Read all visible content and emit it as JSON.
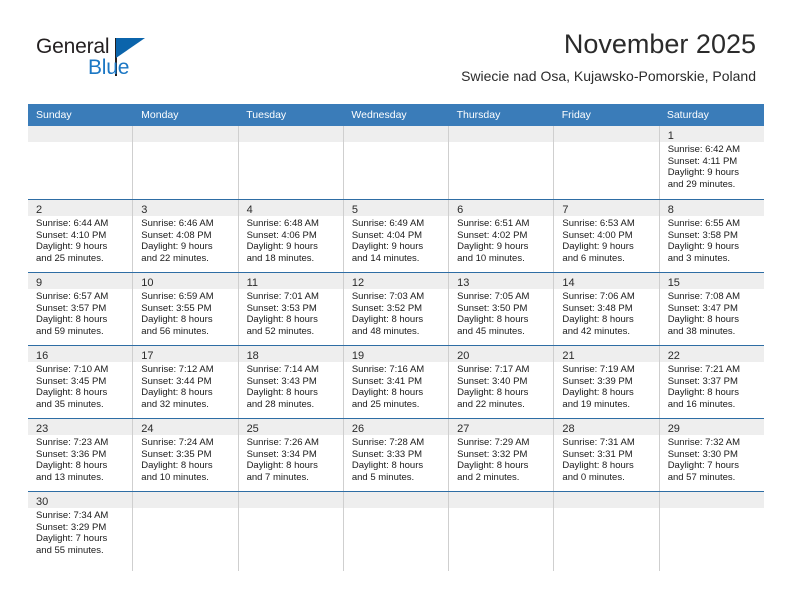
{
  "brand": {
    "name_part1": "General",
    "name_part2": "Blue",
    "logo_icon": "blue-flag-triangle-icon"
  },
  "header": {
    "month_title": "November 2025",
    "location": "Swiecie nad Osa, Kujawsko-Pomorskie, Poland"
  },
  "colors": {
    "header_blue": "#3a7cb9",
    "row_divider_blue": "#2e6da4",
    "daynum_band": "#eeeeee",
    "brand_blue": "#1b77c4",
    "cell_border": "#cfcfcf"
  },
  "calendar": {
    "day_headers": [
      "Sunday",
      "Monday",
      "Tuesday",
      "Wednesday",
      "Thursday",
      "Friday",
      "Saturday"
    ],
    "weeks": [
      [
        {
          "day": "",
          "lines": []
        },
        {
          "day": "",
          "lines": []
        },
        {
          "day": "",
          "lines": []
        },
        {
          "day": "",
          "lines": []
        },
        {
          "day": "",
          "lines": []
        },
        {
          "day": "",
          "lines": []
        },
        {
          "day": "1",
          "lines": [
            "Sunrise: 6:42 AM",
            "Sunset: 4:11 PM",
            "Daylight: 9 hours",
            "and 29 minutes."
          ]
        }
      ],
      [
        {
          "day": "2",
          "lines": [
            "Sunrise: 6:44 AM",
            "Sunset: 4:10 PM",
            "Daylight: 9 hours",
            "and 25 minutes."
          ]
        },
        {
          "day": "3",
          "lines": [
            "Sunrise: 6:46 AM",
            "Sunset: 4:08 PM",
            "Daylight: 9 hours",
            "and 22 minutes."
          ]
        },
        {
          "day": "4",
          "lines": [
            "Sunrise: 6:48 AM",
            "Sunset: 4:06 PM",
            "Daylight: 9 hours",
            "and 18 minutes."
          ]
        },
        {
          "day": "5",
          "lines": [
            "Sunrise: 6:49 AM",
            "Sunset: 4:04 PM",
            "Daylight: 9 hours",
            "and 14 minutes."
          ]
        },
        {
          "day": "6",
          "lines": [
            "Sunrise: 6:51 AM",
            "Sunset: 4:02 PM",
            "Daylight: 9 hours",
            "and 10 minutes."
          ]
        },
        {
          "day": "7",
          "lines": [
            "Sunrise: 6:53 AM",
            "Sunset: 4:00 PM",
            "Daylight: 9 hours",
            "and 6 minutes."
          ]
        },
        {
          "day": "8",
          "lines": [
            "Sunrise: 6:55 AM",
            "Sunset: 3:58 PM",
            "Daylight: 9 hours",
            "and 3 minutes."
          ]
        }
      ],
      [
        {
          "day": "9",
          "lines": [
            "Sunrise: 6:57 AM",
            "Sunset: 3:57 PM",
            "Daylight: 8 hours",
            "and 59 minutes."
          ]
        },
        {
          "day": "10",
          "lines": [
            "Sunrise: 6:59 AM",
            "Sunset: 3:55 PM",
            "Daylight: 8 hours",
            "and 56 minutes."
          ]
        },
        {
          "day": "11",
          "lines": [
            "Sunrise: 7:01 AM",
            "Sunset: 3:53 PM",
            "Daylight: 8 hours",
            "and 52 minutes."
          ]
        },
        {
          "day": "12",
          "lines": [
            "Sunrise: 7:03 AM",
            "Sunset: 3:52 PM",
            "Daylight: 8 hours",
            "and 48 minutes."
          ]
        },
        {
          "day": "13",
          "lines": [
            "Sunrise: 7:05 AM",
            "Sunset: 3:50 PM",
            "Daylight: 8 hours",
            "and 45 minutes."
          ]
        },
        {
          "day": "14",
          "lines": [
            "Sunrise: 7:06 AM",
            "Sunset: 3:48 PM",
            "Daylight: 8 hours",
            "and 42 minutes."
          ]
        },
        {
          "day": "15",
          "lines": [
            "Sunrise: 7:08 AM",
            "Sunset: 3:47 PM",
            "Daylight: 8 hours",
            "and 38 minutes."
          ]
        }
      ],
      [
        {
          "day": "16",
          "lines": [
            "Sunrise: 7:10 AM",
            "Sunset: 3:45 PM",
            "Daylight: 8 hours",
            "and 35 minutes."
          ]
        },
        {
          "day": "17",
          "lines": [
            "Sunrise: 7:12 AM",
            "Sunset: 3:44 PM",
            "Daylight: 8 hours",
            "and 32 minutes."
          ]
        },
        {
          "day": "18",
          "lines": [
            "Sunrise: 7:14 AM",
            "Sunset: 3:43 PM",
            "Daylight: 8 hours",
            "and 28 minutes."
          ]
        },
        {
          "day": "19",
          "lines": [
            "Sunrise: 7:16 AM",
            "Sunset: 3:41 PM",
            "Daylight: 8 hours",
            "and 25 minutes."
          ]
        },
        {
          "day": "20",
          "lines": [
            "Sunrise: 7:17 AM",
            "Sunset: 3:40 PM",
            "Daylight: 8 hours",
            "and 22 minutes."
          ]
        },
        {
          "day": "21",
          "lines": [
            "Sunrise: 7:19 AM",
            "Sunset: 3:39 PM",
            "Daylight: 8 hours",
            "and 19 minutes."
          ]
        },
        {
          "day": "22",
          "lines": [
            "Sunrise: 7:21 AM",
            "Sunset: 3:37 PM",
            "Daylight: 8 hours",
            "and 16 minutes."
          ]
        }
      ],
      [
        {
          "day": "23",
          "lines": [
            "Sunrise: 7:23 AM",
            "Sunset: 3:36 PM",
            "Daylight: 8 hours",
            "and 13 minutes."
          ]
        },
        {
          "day": "24",
          "lines": [
            "Sunrise: 7:24 AM",
            "Sunset: 3:35 PM",
            "Daylight: 8 hours",
            "and 10 minutes."
          ]
        },
        {
          "day": "25",
          "lines": [
            "Sunrise: 7:26 AM",
            "Sunset: 3:34 PM",
            "Daylight: 8 hours",
            "and 7 minutes."
          ]
        },
        {
          "day": "26",
          "lines": [
            "Sunrise: 7:28 AM",
            "Sunset: 3:33 PM",
            "Daylight: 8 hours",
            "and 5 minutes."
          ]
        },
        {
          "day": "27",
          "lines": [
            "Sunrise: 7:29 AM",
            "Sunset: 3:32 PM",
            "Daylight: 8 hours",
            "and 2 minutes."
          ]
        },
        {
          "day": "28",
          "lines": [
            "Sunrise: 7:31 AM",
            "Sunset: 3:31 PM",
            "Daylight: 8 hours",
            "and 0 minutes."
          ]
        },
        {
          "day": "29",
          "lines": [
            "Sunrise: 7:32 AM",
            "Sunset: 3:30 PM",
            "Daylight: 7 hours",
            "and 57 minutes."
          ]
        }
      ],
      [
        {
          "day": "30",
          "lines": [
            "Sunrise: 7:34 AM",
            "Sunset: 3:29 PM",
            "Daylight: 7 hours",
            "and 55 minutes."
          ]
        },
        {
          "day": "",
          "lines": []
        },
        {
          "day": "",
          "lines": []
        },
        {
          "day": "",
          "lines": []
        },
        {
          "day": "",
          "lines": []
        },
        {
          "day": "",
          "lines": []
        },
        {
          "day": "",
          "lines": []
        }
      ]
    ]
  }
}
